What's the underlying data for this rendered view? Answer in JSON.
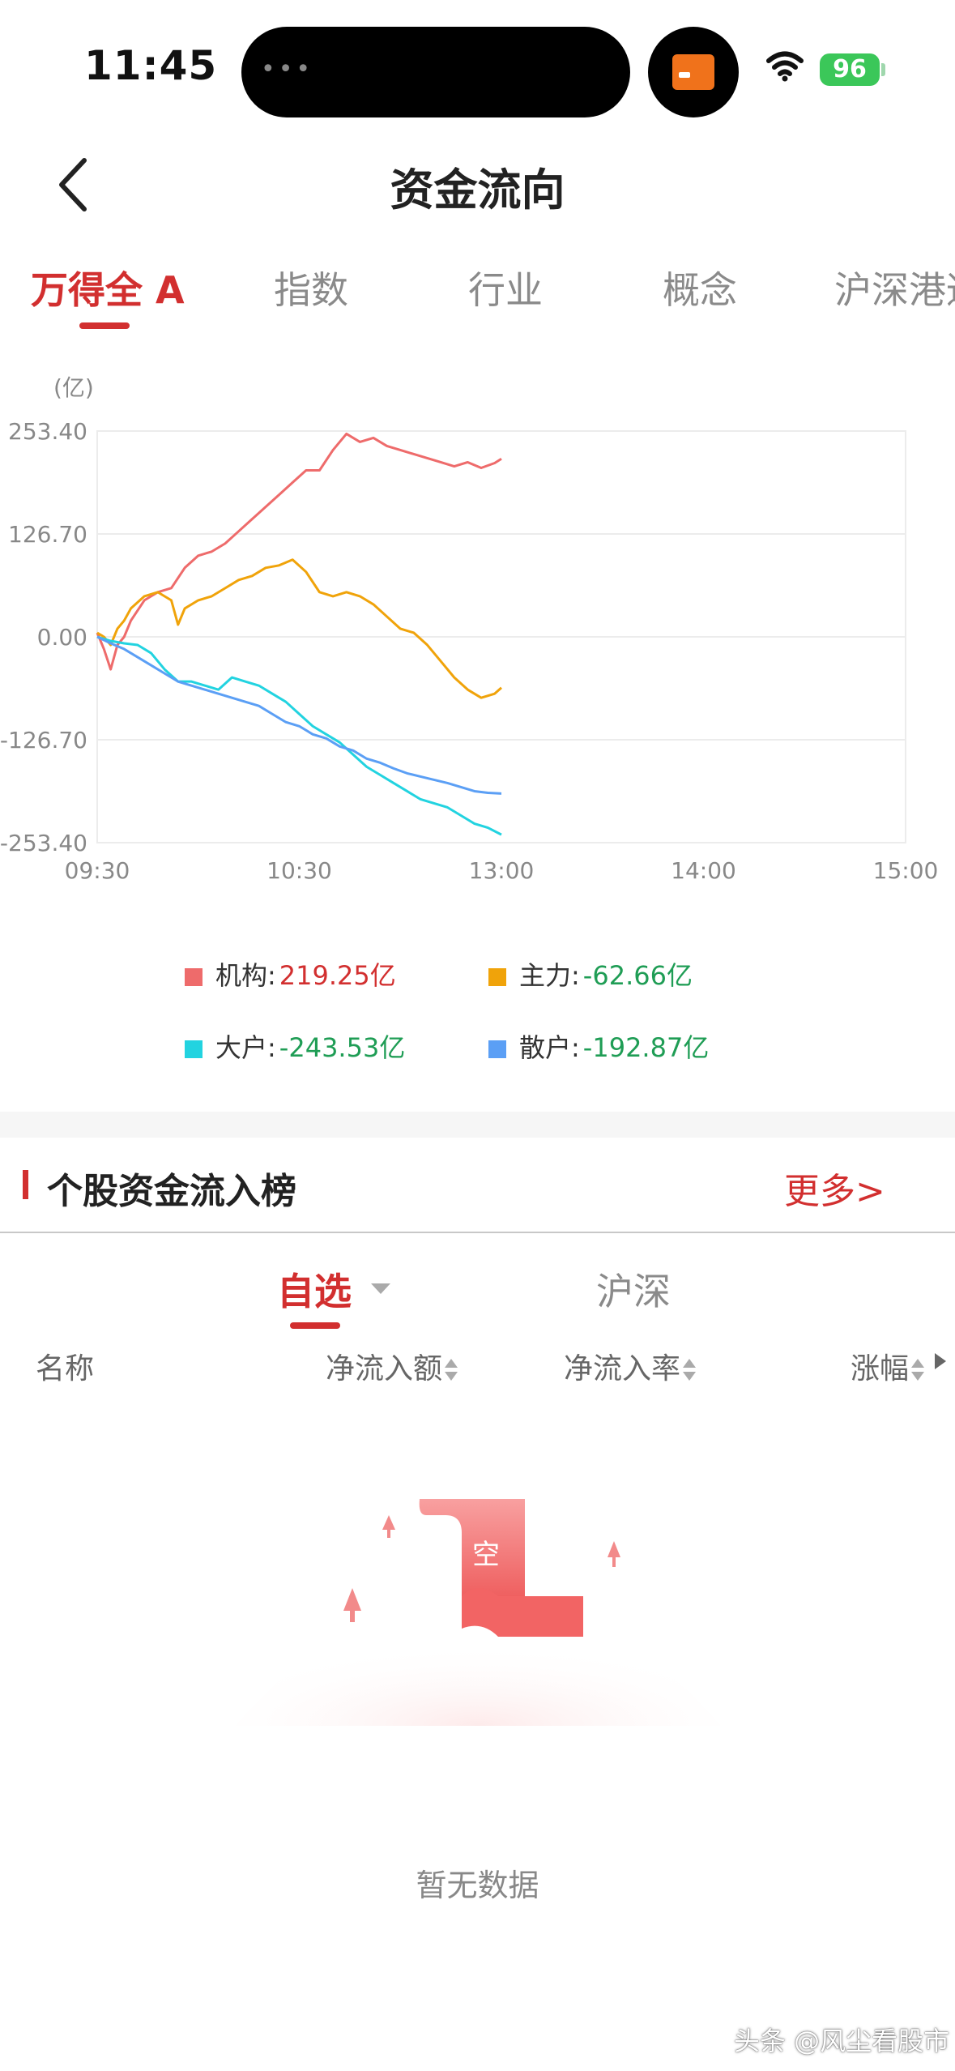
{
  "status_bar": {
    "time": "11:45",
    "battery": "96",
    "island_dots": "•••",
    "wifi_icon": "wifi-icon",
    "battery_icon": "battery-icon"
  },
  "header": {
    "title": "资金流向",
    "back_icon": "chevron-left-icon"
  },
  "tabs": [
    {
      "label": "万得全 A",
      "active": true
    },
    {
      "label": "指数",
      "active": false
    },
    {
      "label": "行业",
      "active": false
    },
    {
      "label": "概念",
      "active": false
    },
    {
      "label": "沪深港通",
      "active": false
    }
  ],
  "chart_data": {
    "type": "line",
    "unit_label": "(亿)",
    "y_ticks": [
      "253.40",
      "126.70",
      "0.00",
      "-126.70",
      "-253.40"
    ],
    "ylim": [
      -253.4,
      253.4
    ],
    "x_ticks": [
      "09:30",
      "10:30",
      "13:00",
      "14:00",
      "15:00"
    ],
    "x_domain_minutes": [
      0,
      240
    ],
    "grid": true,
    "series": [
      {
        "name": "机构",
        "color": "#ee6b6b",
        "x": [
          0,
          2,
          4,
          6,
          8,
          10,
          14,
          18,
          22,
          26,
          30,
          34,
          38,
          42,
          46,
          50,
          54,
          58,
          62,
          66,
          70,
          74,
          78,
          82,
          86,
          90,
          94,
          98,
          102,
          106,
          110,
          114,
          118,
          120
        ],
        "y": [
          5,
          -15,
          -40,
          -10,
          0,
          20,
          45,
          55,
          60,
          85,
          100,
          105,
          115,
          130,
          145,
          160,
          175,
          190,
          205,
          205,
          230,
          250,
          240,
          245,
          235,
          230,
          225,
          220,
          215,
          210,
          215,
          208,
          214,
          219.25
        ]
      },
      {
        "name": "主力",
        "color": "#f0a30a",
        "x": [
          0,
          2,
          4,
          6,
          8,
          10,
          14,
          18,
          22,
          24,
          26,
          30,
          34,
          38,
          42,
          46,
          50,
          54,
          58,
          62,
          66,
          70,
          74,
          78,
          82,
          86,
          90,
          94,
          98,
          102,
          106,
          110,
          114,
          118,
          120
        ],
        "y": [
          5,
          0,
          -10,
          10,
          20,
          35,
          50,
          55,
          45,
          15,
          35,
          45,
          50,
          60,
          70,
          75,
          85,
          88,
          95,
          80,
          55,
          50,
          55,
          50,
          40,
          25,
          10,
          5,
          -10,
          -30,
          -50,
          -65,
          -75,
          -70,
          -62.66
        ]
      },
      {
        "name": "大户",
        "color": "#22d3e0",
        "x": [
          0,
          4,
          8,
          12,
          16,
          20,
          24,
          28,
          32,
          36,
          40,
          44,
          48,
          52,
          56,
          60,
          64,
          68,
          72,
          76,
          80,
          84,
          88,
          92,
          96,
          100,
          104,
          108,
          112,
          116,
          120
        ],
        "y": [
          0,
          -5,
          -8,
          -10,
          -20,
          -40,
          -55,
          -55,
          -60,
          -65,
          -50,
          -55,
          -60,
          -70,
          -80,
          -95,
          -110,
          -120,
          -130,
          -145,
          -160,
          -170,
          -180,
          -190,
          -200,
          -205,
          -210,
          -220,
          -230,
          -235,
          -243.53
        ]
      },
      {
        "name": "散户",
        "color": "#5b9ff5",
        "x": [
          0,
          4,
          8,
          12,
          16,
          20,
          24,
          28,
          32,
          36,
          40,
          44,
          48,
          52,
          56,
          60,
          64,
          68,
          72,
          76,
          80,
          84,
          88,
          92,
          96,
          100,
          104,
          108,
          112,
          116,
          120
        ],
        "y": [
          0,
          -8,
          -15,
          -25,
          -35,
          -45,
          -55,
          -60,
          -65,
          -70,
          -75,
          -80,
          -85,
          -95,
          -105,
          -110,
          -120,
          -125,
          -135,
          -140,
          -150,
          -155,
          -162,
          -168,
          -172,
          -176,
          -180,
          -185,
          -190,
          -192,
          -192.87
        ]
      }
    ]
  },
  "legend": [
    {
      "name": "机构",
      "value": "219.25亿",
      "color": "#ee6b6b",
      "positive": true
    },
    {
      "name": "主力",
      "value": "-62.66亿",
      "color": "#f0a30a",
      "positive": false
    },
    {
      "name": "大户",
      "value": "-243.53亿",
      "color": "#22d3e0",
      "positive": false
    },
    {
      "name": "散户",
      "value": "-192.87亿",
      "color": "#5b9ff5",
      "positive": false
    }
  ],
  "section": {
    "title": "个股资金流入榜",
    "more": "更多>"
  },
  "sub_tabs": [
    {
      "label": "自选",
      "active": true
    },
    {
      "label": "沪深",
      "active": false
    }
  ],
  "columns": [
    "名称",
    "净流入额",
    "净流入率",
    "涨幅"
  ],
  "empty_state": {
    "badge": "空",
    "text": "暂无数据"
  },
  "watermark": "头条 @风尘看股市"
}
